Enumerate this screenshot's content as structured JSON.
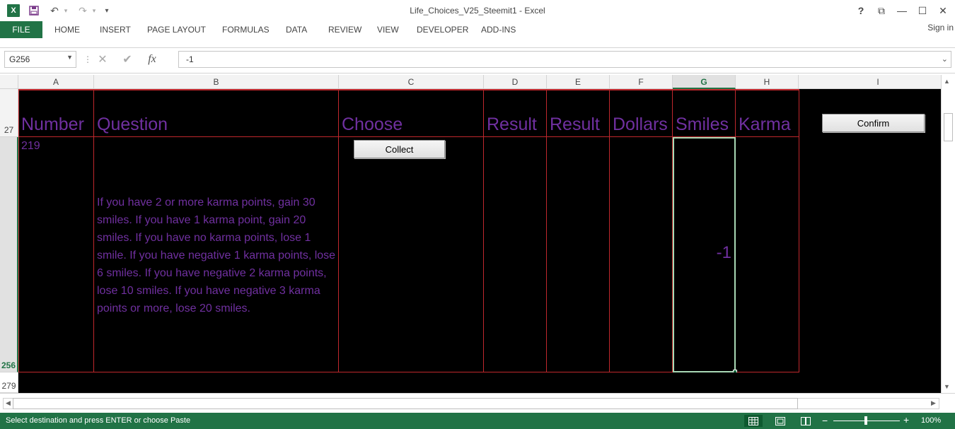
{
  "window": {
    "title": "Life_Choices_V25_Steemit1 - Excel",
    "help": "?",
    "ribbon_display": "⧉",
    "minimize": "—",
    "maximize": "☐",
    "close": "✕"
  },
  "quick_access": {
    "logo": "X",
    "save": "💾",
    "undo": "↶",
    "redo": "↷",
    "customize": "▾"
  },
  "ribbon": {
    "file": "FILE",
    "tabs": [
      "HOME",
      "INSERT",
      "PAGE LAYOUT",
      "FORMULAS",
      "DATA",
      "REVIEW",
      "VIEW",
      "DEVELOPER",
      "ADD-INS"
    ],
    "sign_in": "Sign in"
  },
  "formula_bar": {
    "name_box": "G256",
    "cancel": "✕",
    "enter": "✔",
    "fx": "fx",
    "value": "-1"
  },
  "sheet": {
    "columns": [
      "A",
      "B",
      "C",
      "D",
      "E",
      "F",
      "G",
      "H",
      "I"
    ],
    "selected_column": "G",
    "rows": [
      "27",
      "256",
      "279"
    ],
    "selected_row": "256",
    "header_row": [
      "Number",
      "Question",
      "Choose",
      "Result",
      "Result",
      "Dollars",
      "Smiles",
      "Karma"
    ],
    "number": "219",
    "question": "If you have 2 or more karma points, gain 30 smiles. If you have 1 karma point, gain 20 smiles. If you have no karma points, lose 1 smile. If you have negative 1 karma points, lose 6 smiles. If you have negative 2 karma points, lose 10 smiles. If you have negative 3 karma points or more, lose 20 smiles.",
    "smiles_value": "-1",
    "collect_button": "Collect",
    "confirm_button": "Confirm"
  },
  "status_bar": {
    "message": "Select destination and press ENTER or choose Paste",
    "zoom": "100%",
    "zoom_minus": "−",
    "zoom_plus": "+"
  },
  "colors": {
    "excel_green": "#217346",
    "grid_red": "#c0282d",
    "text_purple": "#7030a0",
    "sheet_bg": "#000000"
  }
}
